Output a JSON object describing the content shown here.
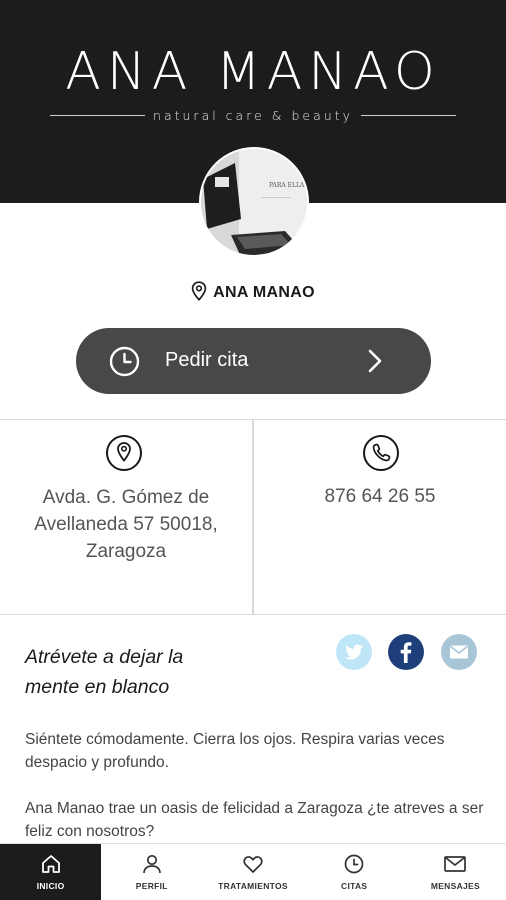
{
  "header": {
    "logo_title": "ANA MANAO",
    "logo_subtitle": "natural care & beauty"
  },
  "profile": {
    "location_name": "ANA MANAO",
    "photo_sign_text": "PARA ELLA"
  },
  "cta": {
    "label": "Pedir cita"
  },
  "contact": {
    "address_line1": "Avda. G. Gómez de",
    "address_line2": "Avellaneda 57 50018,",
    "address_line3": "Zaragoza",
    "phone": "876 64 26 55"
  },
  "about": {
    "tagline_line1": "Atrévete a dejar la",
    "tagline_line2": "mente en blanco",
    "paragraph1": "Siéntete cómodamente. Cierra los ojos. Respira varias veces despacio y profundo.",
    "paragraph2": "Ana Manao trae un oasis de felicidad a Zaragoza ¿te atreves a ser feliz con nosotros?"
  },
  "social": {
    "twitter_color": "#bfe6f7",
    "facebook_color": "#1f3f7a",
    "email_color": "#a9c6d8"
  },
  "tabs": [
    {
      "label": "INICIO",
      "icon": "home-icon",
      "active": true
    },
    {
      "label": "PERFIL",
      "icon": "user-icon",
      "active": false
    },
    {
      "label": "TRATAMIENTOS",
      "icon": "heart-icon",
      "active": false
    },
    {
      "label": "CITAS",
      "icon": "clock-icon",
      "active": false
    },
    {
      "label": "MENSAJES",
      "icon": "envelope-icon",
      "active": false
    }
  ]
}
